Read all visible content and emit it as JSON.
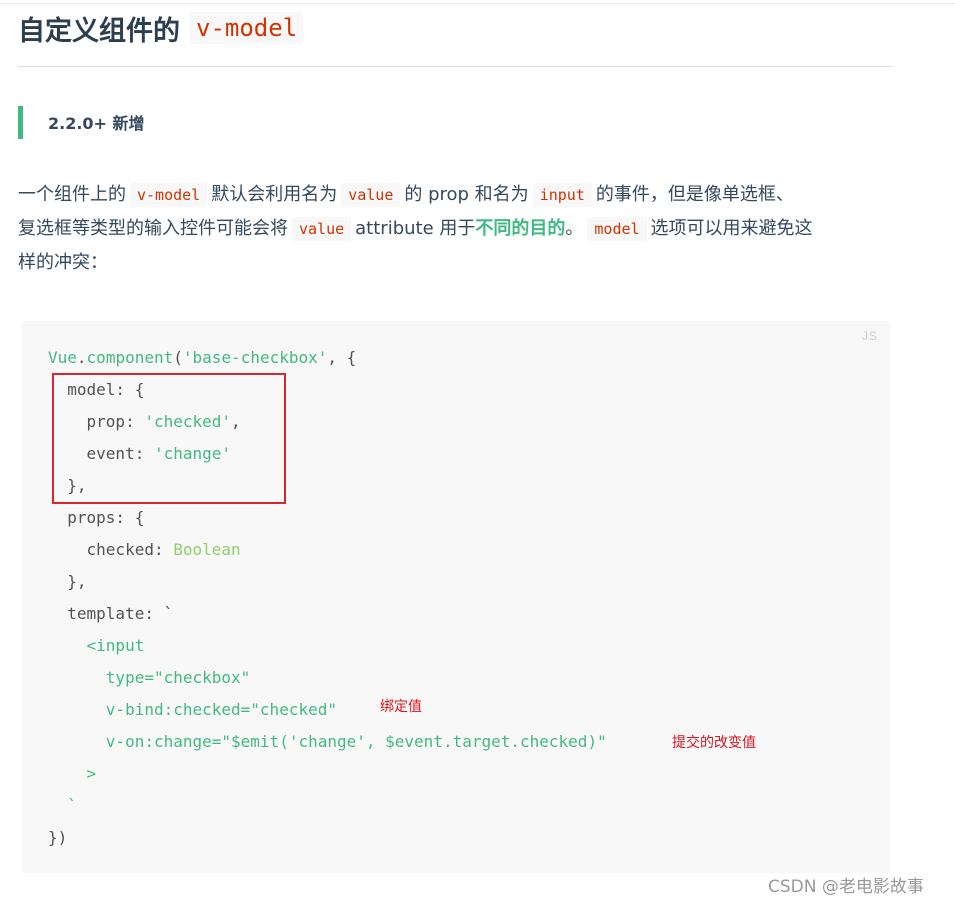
{
  "heading": {
    "title": "自定义组件的",
    "code": "v-model"
  },
  "tip": {
    "text": "2.2.0+ 新增"
  },
  "paragraph": {
    "l1_a": "一个组件上的",
    "l1_code1": "v-model",
    "l1_b": "默认会利用名为",
    "l1_code2": "value",
    "l1_c": "的 prop 和名为",
    "l1_code3": "input",
    "l1_d": "的事件，但是像单选框、",
    "l2_a": "复选框等类型的输入控件可能会将",
    "l2_code1": "value",
    "l2_b": "attribute 用于",
    "l2_strong": "不同的目的",
    "l2_c": "。",
    "l2_code2": "model",
    "l2_d": "选项可以用来避免这",
    "l3_a": "样的冲突："
  },
  "code_block": {
    "lang": "JS",
    "l1_a": "Vue",
    "l1_b": ".",
    "l1_c": "component",
    "l1_d": "(",
    "l1_e": "'base-checkbox'",
    "l1_f": ", {",
    "l2": "  model: {",
    "l3_a": "    prop: ",
    "l3_b": "'checked'",
    "l3_c": ",",
    "l4_a": "    event: ",
    "l4_b": "'change'",
    "l5": "  },",
    "l6": "  props: {",
    "l7_a": "    checked: ",
    "l7_b": "Boolean",
    "l8": "  },",
    "l9": "  template: `",
    "l10": "    <input",
    "l11": "      type=\"checkbox\"",
    "l12": "      v-bind:checked=\"checked\"",
    "l13": "      v-on:change=\"$emit('change', $event.target.checked)\"",
    "l14": "    >",
    "l15": "  `",
    "l16": "})"
  },
  "annotations": {
    "bind_value": "绑定值",
    "submit_value": "提交的改变值"
  },
  "watermark": "CSDN @老电影故事",
  "colors": {
    "accent_green": "#42b983",
    "inline_code": "#d63200",
    "annotation_red": "#e0141e"
  }
}
